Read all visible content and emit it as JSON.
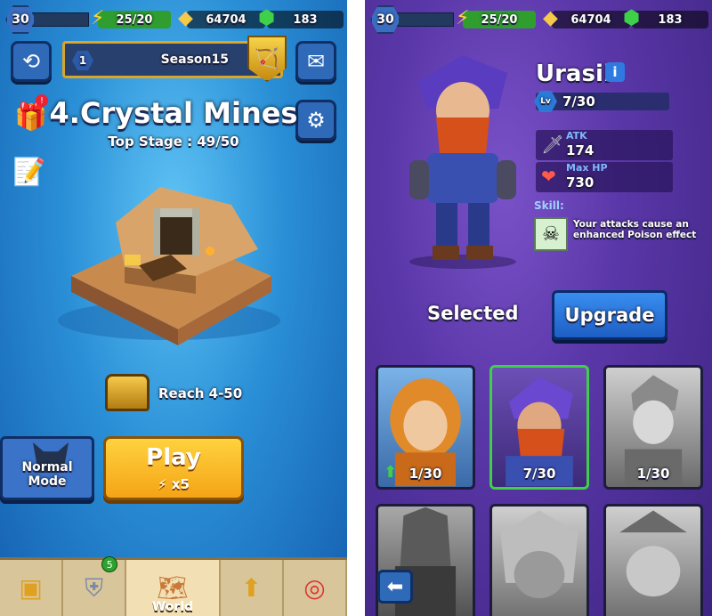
{
  "topbar": {
    "level": "30",
    "energy": "25/20",
    "gold": "64704",
    "gems": "183"
  },
  "left": {
    "season": {
      "number": "1",
      "label": "Season15"
    },
    "stage_title": "4.Crystal Mines",
    "top_stage": "Top Stage : 49/50",
    "reward": "Reach 4-50",
    "mode_button": "Normal Mode",
    "play_button": "Play",
    "play_cost": "x5",
    "nav": [
      {
        "label": ""
      },
      {
        "label": "",
        "badge": "5"
      },
      {
        "label": "World"
      },
      {
        "label": ""
      },
      {
        "label": ""
      }
    ]
  },
  "right": {
    "hero_name": "Urasil",
    "level": "7/30",
    "level_icon": "Lv",
    "atk_label": "ATK",
    "atk_value": "174",
    "hp_label": "Max HP",
    "hp_value": "730",
    "skill_label": "Skill:",
    "skill_desc": "Your attacks cause an enhanced Poison effect",
    "selected_label": "Selected",
    "upgrade_button": "Upgrade",
    "cards": [
      {
        "level": "1/30"
      },
      {
        "level": "7/30"
      },
      {
        "level": "1/30"
      }
    ]
  },
  "colors": {
    "left_bg": "#2a8fd6",
    "right_bg": "#5a37a8",
    "play_button": "#f4a416",
    "upgrade_button": "#1e5fc4",
    "selected_card_border": "#3fd04a"
  }
}
